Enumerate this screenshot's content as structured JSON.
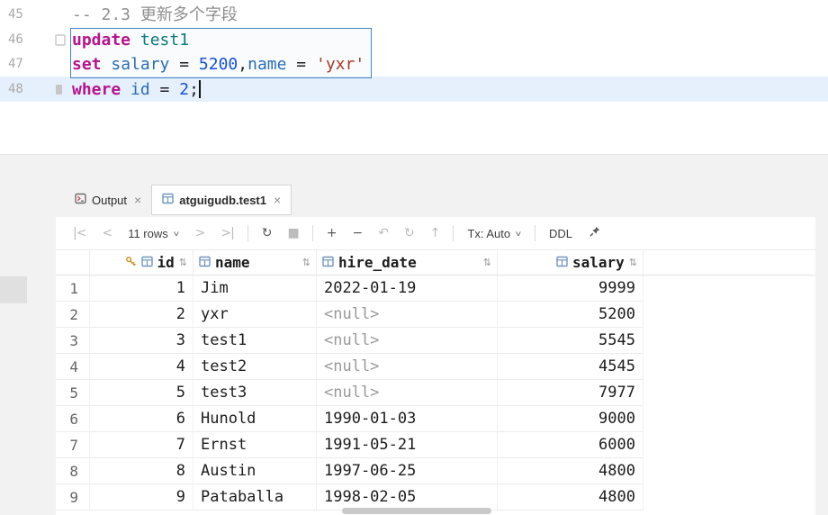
{
  "accent_color": "#4585c6",
  "editor": {
    "lines": [
      {
        "number": "45",
        "segments": [
          {
            "t": "-- 2.3 更新多个字段",
            "c": "comment"
          }
        ]
      },
      {
        "number": "46",
        "gutter_icon": "fold-marker",
        "segments": [
          {
            "t": "update",
            "c": "keyword"
          },
          {
            "t": " ",
            "c": "plain"
          },
          {
            "t": "test1",
            "c": "table"
          }
        ]
      },
      {
        "number": "47",
        "segments": [
          {
            "t": "set",
            "c": "keyword"
          },
          {
            "t": " ",
            "c": "plain"
          },
          {
            "t": "salary",
            "c": "field"
          },
          {
            "t": " = ",
            "c": "plain"
          },
          {
            "t": "5200",
            "c": "number"
          },
          {
            "t": ",",
            "c": "plain"
          },
          {
            "t": "name",
            "c": "field"
          },
          {
            "t": " = ",
            "c": "plain"
          },
          {
            "t": "'yxr'",
            "c": "string"
          }
        ]
      },
      {
        "number": "48",
        "current": true,
        "caret": true,
        "gutter_icon": "edit-marker",
        "segments": [
          {
            "t": "where",
            "c": "keyword"
          },
          {
            "t": " ",
            "c": "plain"
          },
          {
            "t": "id",
            "c": "field"
          },
          {
            "t": " = ",
            "c": "plain"
          },
          {
            "t": "2",
            "c": "number"
          },
          {
            "t": ";",
            "c": "plain"
          }
        ]
      }
    ]
  },
  "tool_window": {
    "tabs": [
      {
        "label": "Output",
        "icon": "console",
        "close": "×",
        "active": false
      },
      {
        "label": "atguigudb.test1",
        "icon": "table",
        "close": "×",
        "active": true
      }
    ],
    "toolbar": {
      "items": [
        {
          "name": "first-page-button",
          "glyph": "|<",
          "state": "dim"
        },
        {
          "name": "previous-page-button",
          "glyph": "<",
          "state": "dim"
        },
        {
          "name": "page-size-dropdown",
          "label": "11 rows",
          "chevron": "∨",
          "state": "normal"
        },
        {
          "name": "next-page-button",
          "glyph": ">",
          "state": "dim"
        },
        {
          "name": "last-page-button",
          "glyph": ">|",
          "state": "dim"
        },
        {
          "sep": true
        },
        {
          "name": "reload-data-button",
          "glyph": "↻",
          "state": "normal"
        },
        {
          "name": "stop-button",
          "glyph": "■",
          "state": "dim"
        },
        {
          "sep": true
        },
        {
          "name": "add-row-button",
          "glyph": "+",
          "state": "normal"
        },
        {
          "name": "delete-row-button",
          "glyph": "−",
          "state": "normal"
        },
        {
          "name": "revert-changes-button",
          "glyph": "↶",
          "state": "dim"
        },
        {
          "name": "refresh-rows-button",
          "glyph": "↻",
          "state": "dim"
        },
        {
          "name": "submit-button",
          "glyph": "↑",
          "state": "dim"
        },
        {
          "sep": true
        },
        {
          "name": "tx-mode-dropdown",
          "label": "Tx: Auto",
          "chevron": "∨",
          "state": "normal"
        },
        {
          "sep": true
        },
        {
          "name": "ddl-button",
          "label": "DDL",
          "state": "normal"
        },
        {
          "name": "pin-button",
          "icon": "pin",
          "state": "normal"
        }
      ]
    },
    "grid": {
      "null_text": "<null>",
      "sort_glyph": "⇅",
      "columns": [
        {
          "name": "id",
          "align": "right",
          "key_icon": true
        },
        {
          "name": "name",
          "align": "left"
        },
        {
          "name": "hire_date",
          "align": "left"
        },
        {
          "name": "salary",
          "align": "right"
        }
      ],
      "rows": [
        {
          "num": "1",
          "cells": [
            "1",
            "Jim",
            "2022-01-19",
            "9999"
          ]
        },
        {
          "num": "2",
          "cells": [
            "2",
            "yxr",
            "<null>",
            "5200"
          ]
        },
        {
          "num": "3",
          "cells": [
            "3",
            "test1",
            "<null>",
            "5545"
          ]
        },
        {
          "num": "4",
          "cells": [
            "4",
            "test2",
            "<null>",
            "4545"
          ]
        },
        {
          "num": "5",
          "cells": [
            "5",
            "test3",
            "<null>",
            "7977"
          ]
        },
        {
          "num": "6",
          "cells": [
            "6",
            "Hunold",
            "1990-01-03",
            "9000"
          ]
        },
        {
          "num": "7",
          "cells": [
            "7",
            "Ernst",
            "1991-05-21",
            "6000"
          ]
        },
        {
          "num": "8",
          "cells": [
            "8",
            "Austin",
            "1997-06-25",
            "4800"
          ]
        },
        {
          "num": "9",
          "cells": [
            "9",
            "Pataballa",
            "1998-02-05",
            "4800"
          ]
        }
      ]
    }
  }
}
